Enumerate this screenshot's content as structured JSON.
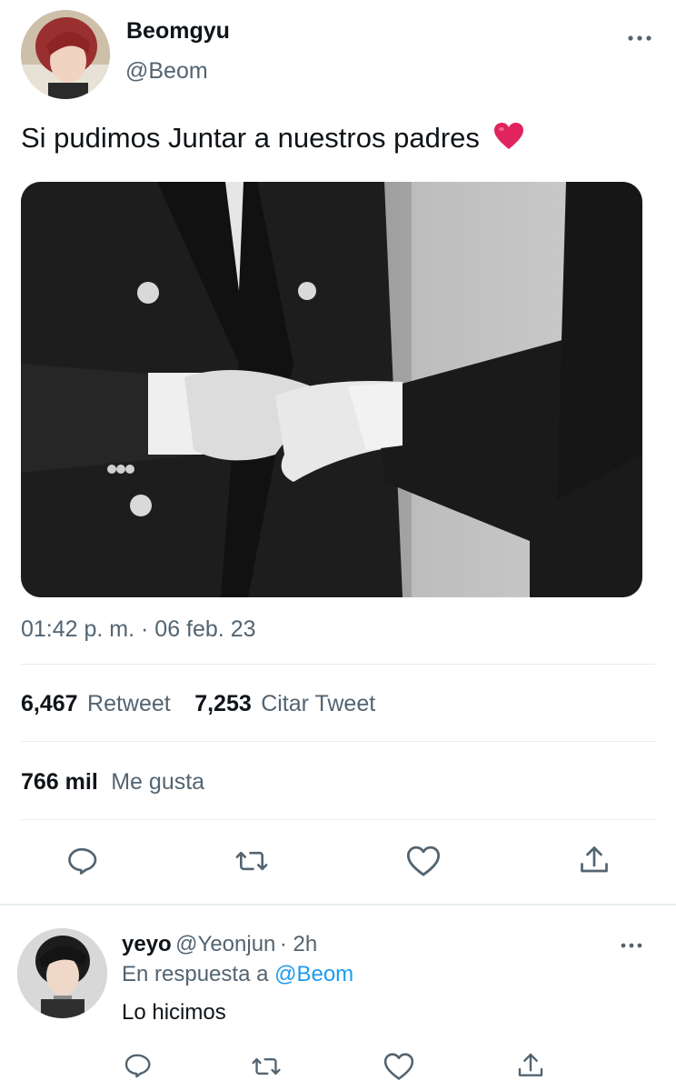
{
  "tweet": {
    "author_name": "Beomgyu",
    "author_handle": "@Beom",
    "text": "Si pudimos Juntar a nuestros padres",
    "emoji": "red-heart",
    "timestamp": "01:42 p. m. · 06 feb. 23",
    "stats": {
      "retweets_count": "6,467",
      "retweets_label": "Retweet",
      "quotes_count": "7,253",
      "quotes_label": "Citar Tweet",
      "likes_count": "766 mil",
      "likes_label": "Me gusta"
    },
    "actions": [
      "reply-icon",
      "retweet-icon",
      "like-icon",
      "share-icon"
    ]
  },
  "reply": {
    "author_name": "yeyo",
    "author_handle": "@Yeonjun",
    "time": "· 2h",
    "replying_prefix": "En respuesta a",
    "replying_to": "@Beom",
    "text": "Lo hicimos",
    "actions": [
      "reply-icon",
      "retweet-icon",
      "like-icon",
      "share-icon"
    ]
  },
  "colors": {
    "text_primary": "#0f1419",
    "text_secondary": "#536471",
    "link": "#1d9bf0",
    "divider": "#e6ecf0",
    "heart": "#e0245e"
  }
}
